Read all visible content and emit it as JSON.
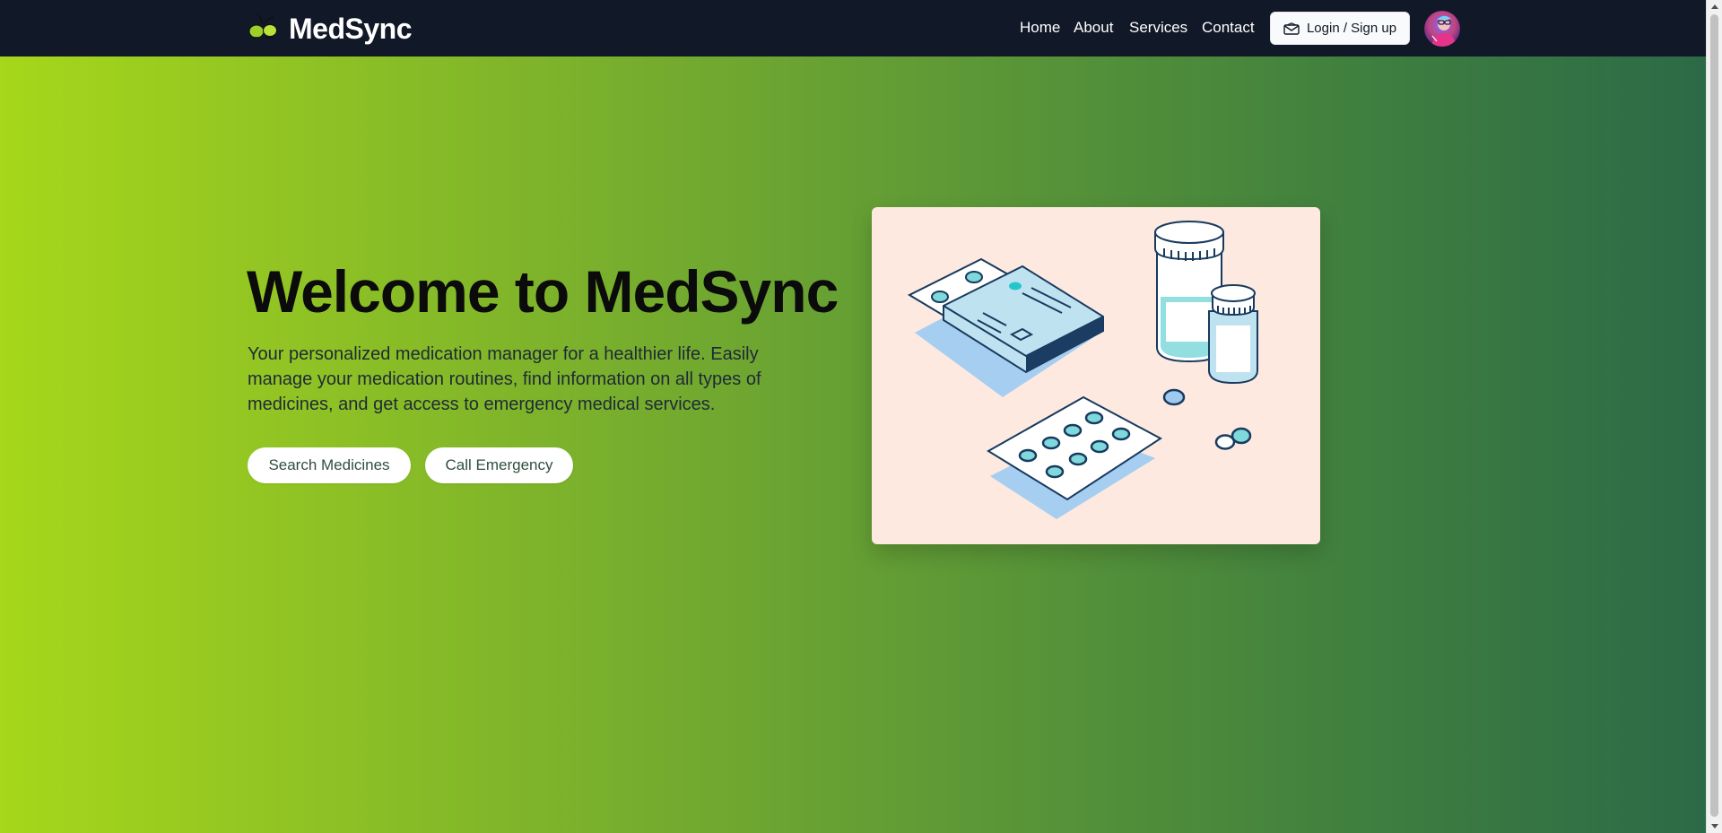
{
  "navbar": {
    "brand_name": "MedSync",
    "links": [
      "Home",
      "About",
      "Services",
      "Contact"
    ],
    "login_label": "Login / Sign up",
    "background": "#111827"
  },
  "hero": {
    "title": "Welcome to MedSync",
    "description": "Your personalized medication manager for a healthier life. Easily manage your medication routines, find information on all types of medicines, and get access to emergency medical services.",
    "search_button": "Search Medicines",
    "emergency_button": "Call Emergency",
    "gradient_start": "#a6d71b",
    "gradient_end": "#2c6a47",
    "card_background": "#fde9df"
  }
}
